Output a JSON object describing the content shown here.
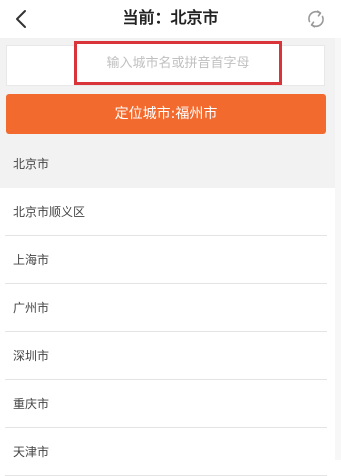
{
  "header": {
    "title": "当前：北京市",
    "back_icon": "chevron-left-icon",
    "refresh_icon": "refresh-icon"
  },
  "search": {
    "placeholder": "输入城市名或拼音首字母",
    "value": ""
  },
  "locate_button": {
    "label": "定位城市:福州市"
  },
  "cities": [
    "北京市",
    "北京市顺义区",
    "上海市",
    "广州市",
    "深圳市",
    "重庆市",
    "天津市"
  ],
  "colors": {
    "accent": "#f26a2e",
    "highlight_border": "#d9343a",
    "background_gray": "#f2f2f2"
  }
}
